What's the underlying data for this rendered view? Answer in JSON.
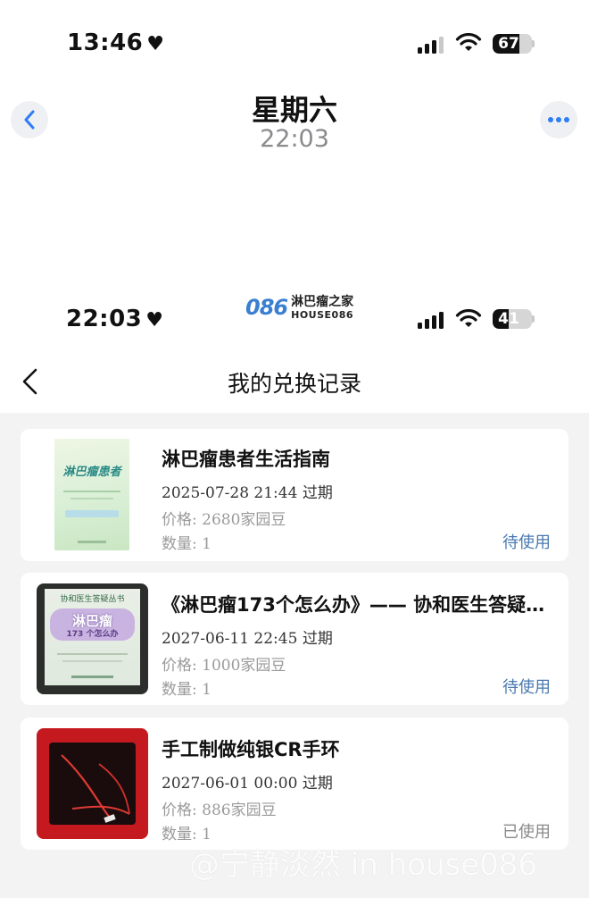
{
  "outer_status": {
    "time": "13:46",
    "battery": "67",
    "battery_level": 0.67
  },
  "inner_status": {
    "time": "22:03",
    "battery": "41",
    "battery_level": 0.41
  },
  "message_header": {
    "day": "星期六",
    "time": "22:03"
  },
  "logo": {
    "brand_number": "086",
    "cn_name": "淋巴瘤之家",
    "en_name": "HOUSE086"
  },
  "page": {
    "title": "我的兑换记录"
  },
  "records": [
    {
      "title": "淋巴瘤患者生活指南",
      "expiry": "2025-07-28 21:44 过期",
      "price": "价格:  2680家园豆",
      "quantity": "数量:  1",
      "status": "待使用",
      "status_color": "#4a79b0",
      "cover_text": "淋巴瘤患者"
    },
    {
      "title": "《淋巴瘤173个怎么办》—— 协和医生答疑…",
      "expiry": "2027-06-11 22:45 过期",
      "price": "价格:  1000家园豆",
      "quantity": "数量:  1",
      "status": "待使用",
      "status_color": "#4a79b0",
      "cover_series": "协和医生答疑丛书",
      "cover_text": "淋巴瘤",
      "cover_sub": "173 个怎么办"
    },
    {
      "title": "手工制做纯银CR手环",
      "expiry": "2027-06-01 00:00 过期",
      "price": "价格:  886家园豆",
      "quantity": "数量:  1",
      "status": "已使用",
      "status_color": "#8a8a8a"
    }
  ],
  "watermark": "@宁静淡然 in house086"
}
